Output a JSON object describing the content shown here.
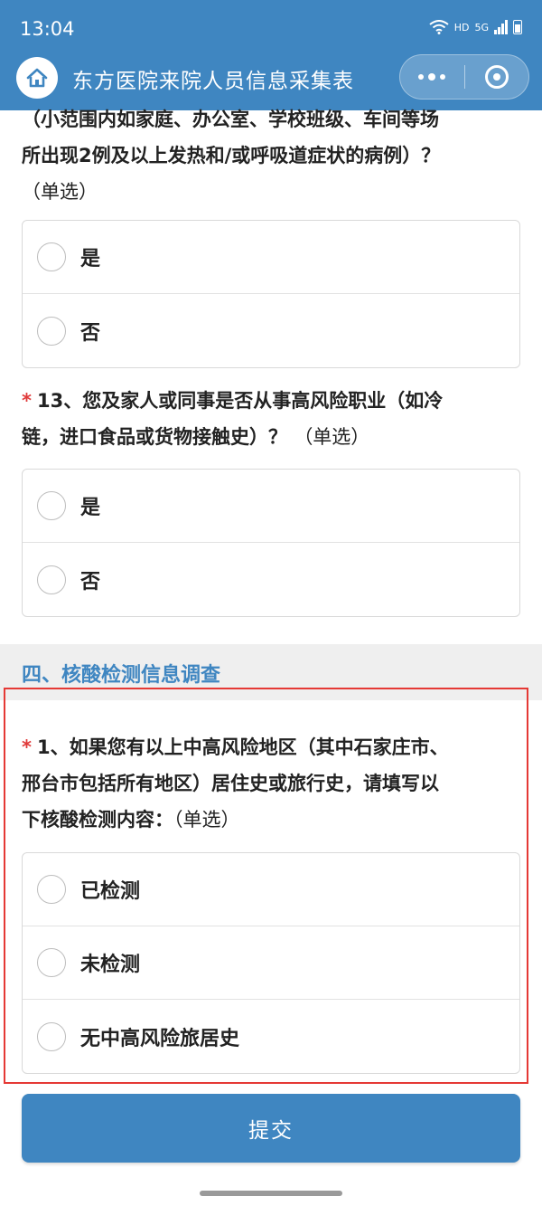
{
  "status_bar": {
    "time": "13:04",
    "hd_label": "HD",
    "net_label": "5G"
  },
  "header": {
    "title": "东方医院来院人员信息采集表"
  },
  "q12": {
    "lines": [
      "（小范围内如家庭、办公室、学校班级、车间等场",
      "所出现2例及以上发热和/或呼吸道症状的病例）？"
    ],
    "hint": "（单选）",
    "options": [
      "是",
      "否"
    ]
  },
  "q13": {
    "star": "*",
    "lines": [
      "13、您及家人或同事是否从事高风险职业（如冷",
      "链，进口食品或货物接触史）？"
    ],
    "hint": "（单选）",
    "options": [
      "是",
      "否"
    ]
  },
  "section4": {
    "title": "四、核酸检测信息调查"
  },
  "q1": {
    "star": "*",
    "lines": [
      "1、如果您有以上中高风险地区（其中石家庄市、",
      "邢台市包括所有地区）居住史或旅行史，请填写以",
      "下核酸检测内容："
    ],
    "hint": "（单选）",
    "options": [
      "已检测",
      "未检测",
      "无中高风险旅居史"
    ]
  },
  "submit": {
    "label": "提交"
  },
  "colors": {
    "header": "#3f86c1",
    "accent": "#3f86c1",
    "required": "#e03a3a",
    "highlight_frame": "#e53935"
  }
}
